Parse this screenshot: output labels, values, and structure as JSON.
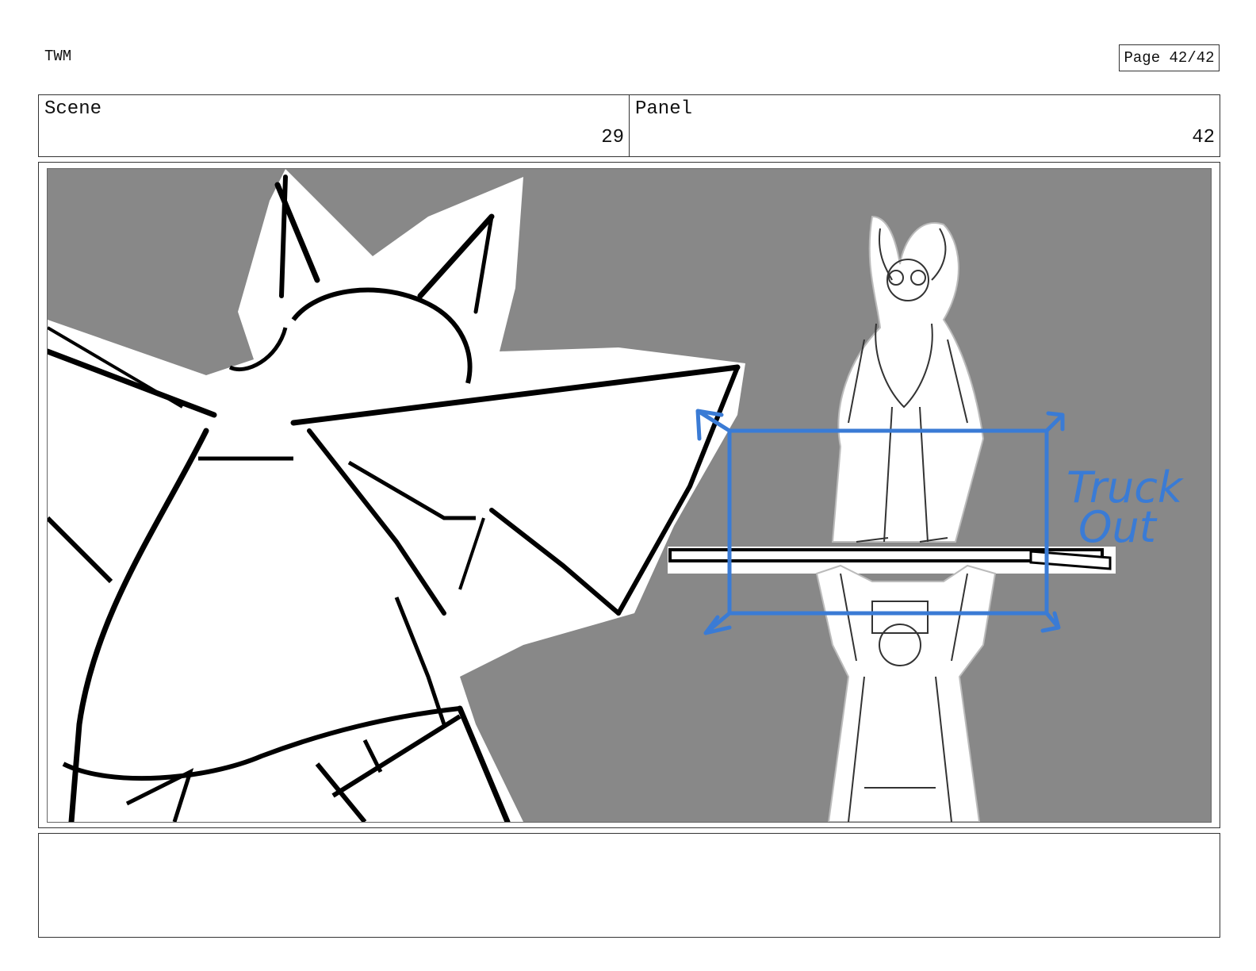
{
  "header": {
    "project": "TWM",
    "page": "Page 42/42"
  },
  "info": {
    "scene_label": "Scene",
    "scene_value": "29",
    "panel_label": "Panel",
    "panel_value": "42"
  },
  "panel_art": {
    "annotation_line1": "Truck",
    "annotation_line2": "Out",
    "annotation_color": "#3a7bd5",
    "background_color": "#888888"
  },
  "notes": {
    "text": ""
  }
}
